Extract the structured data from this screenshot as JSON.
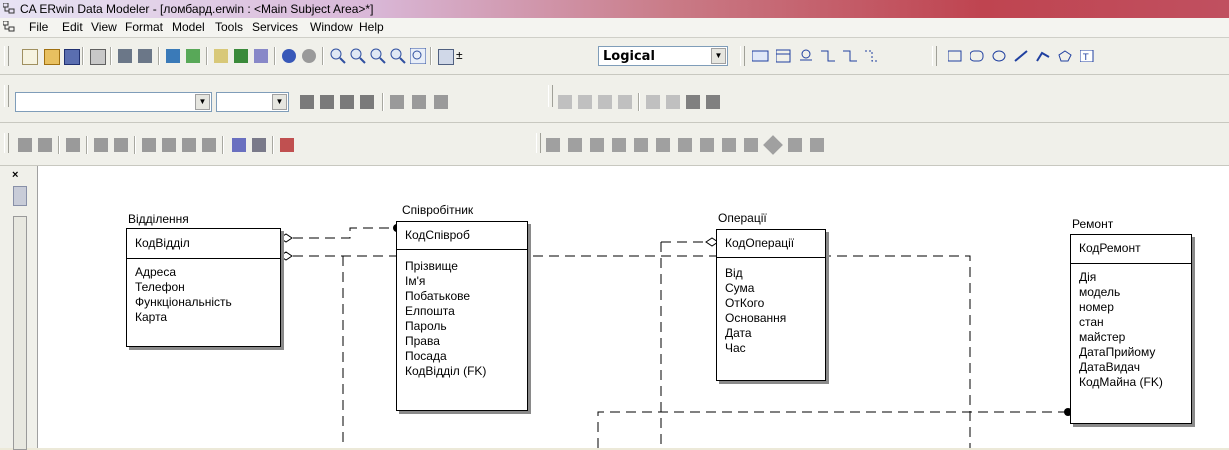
{
  "window": {
    "title": "CA ERwin Data Modeler - [ломбард.erwin : <Main Subject Area>*]"
  },
  "menu": [
    "File",
    "Edit",
    "View",
    "Format",
    "Model",
    "Tools",
    "Services",
    "Window",
    "Help"
  ],
  "toolbar": {
    "view_mode": "Logical",
    "font_name": "",
    "font_size": "",
    "close_glyph": "×"
  },
  "colors": {
    "highlight": "#e0242c",
    "titlebar_end": "#bf4450"
  },
  "entities": [
    {
      "name": "Відділення",
      "pk": "КодВідділ",
      "attrs": [
        "Адреса",
        "Телефон",
        "Функціональність",
        "Карта"
      ]
    },
    {
      "name": "Співробітник",
      "pk": "КодСпівроб",
      "attrs": [
        "Прізвище",
        "Ім'я",
        "Побатькове",
        "Елпошта",
        "Пароль",
        "Права",
        "Посада",
        "КодВідділ (FK)"
      ]
    },
    {
      "name": "Операції",
      "pk": "КодОперації",
      "attrs": [
        "Від",
        "Сума",
        "ОтКого",
        "Основання",
        "Дата",
        "Час"
      ]
    },
    {
      "name": "Ремонт",
      "pk": "КодРемонт",
      "attrs": [
        "Дія",
        "модель",
        "номер",
        "стан",
        "майстер",
        "ДатаПрийому",
        "ДатаВидач",
        "КодМайна (FK)"
      ]
    }
  ]
}
